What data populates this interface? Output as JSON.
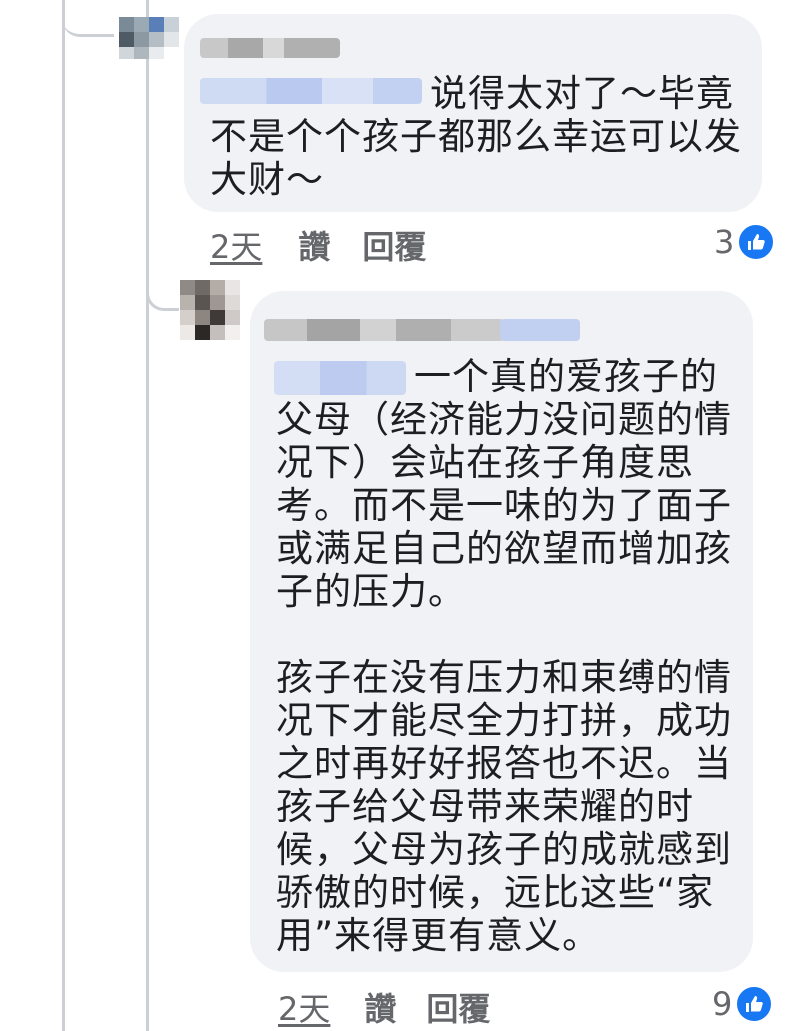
{
  "comments": [
    {
      "text": "说得太对了～毕竟\n不是个个孩子都那么幸运可以发\n大财～",
      "time": "2天",
      "like_label": "讚",
      "reply_label": "回覆",
      "reaction_count": "3"
    },
    {
      "text": "一个真的爱孩子的\n父母（经济能力没问题的情\n况下）会站在孩子角度思\n考。而不是一味的为了面子\n或满足自己的欲望而增加孩\n子的压力。\n\n孩子在没有压力和束缚的情\n况下才能尽全力打拼，成功\n之时再好好报答也不迟。当\n孩子给父母带来荣耀的时\n候，父母为孩子的成就感到\n骄傲的时候，远比这些“家\n用”来得更有意义。",
      "time": "2天",
      "like_label": "讚",
      "reply_label": "回覆",
      "reaction_count": "9"
    }
  ],
  "colors": {
    "bubble": "#f0f2f5",
    "like_blue": "#1877f2",
    "meta_gray": "#65676b"
  },
  "icons": {
    "reaction": "thumbs-up-icon"
  }
}
